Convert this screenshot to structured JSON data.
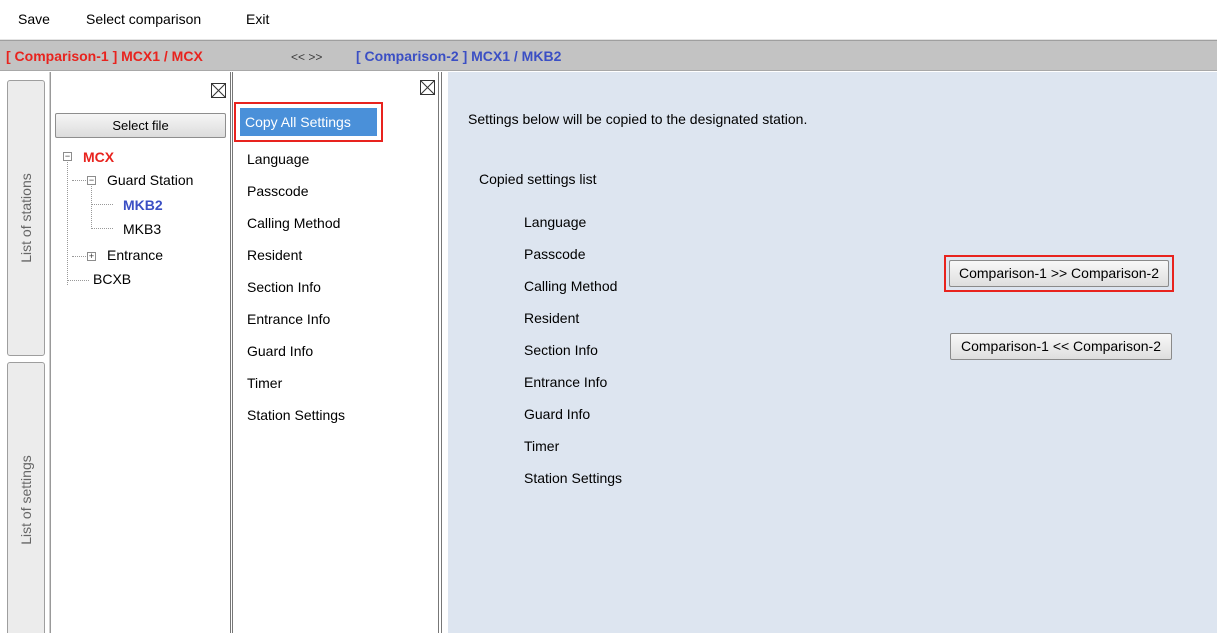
{
  "menu": {
    "items": [
      "Save",
      "Select comparison",
      "Exit"
    ]
  },
  "comparison_bar": {
    "left": "[ Comparison-1 ] MCX1 / MCX",
    "arrows": "<< >>",
    "right": "[ Comparison-2 ] MCX1 / MKB2"
  },
  "vertical_tabs": {
    "stations": "List of stations",
    "settings": "List of settings"
  },
  "station_panel": {
    "select_file_label": "Select file",
    "tree": {
      "root": "MCX",
      "guard_station": "Guard Station",
      "mkb2": "MKB2",
      "mkb3": "MKB3",
      "entrance": "Entrance",
      "bcxb": "BCXB"
    }
  },
  "settings_list": {
    "selected": "Copy All Settings",
    "items": [
      "Language",
      "Passcode",
      "Calling Method",
      "Resident",
      "Section Info",
      "Entrance Info",
      "Guard Info",
      "Timer",
      "Station Settings"
    ]
  },
  "main": {
    "description": "Settings below will be copied to the designated station.",
    "copied_heading": "Copied settings list",
    "copied_items": [
      "Language",
      "Passcode",
      "Calling Method",
      "Resident",
      "Section Info",
      "Entrance Info",
      "Guard Info",
      "Timer",
      "Station Settings"
    ],
    "btn_forward": "Comparison-1 >> Comparison-2",
    "btn_backward": "Comparison-1 << Comparison-2"
  },
  "colors": {
    "comparison_1": "#e8231e",
    "comparison_2": "#3b4fc4",
    "selected_item": "#4a90d9",
    "highlight_frame": "#e8231e",
    "main_background": "#dde5f0"
  }
}
